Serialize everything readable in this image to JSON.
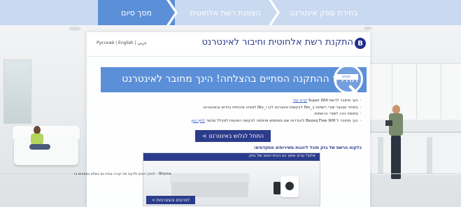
{
  "steps": [
    {
      "label": "מסך סיום",
      "active": true
    },
    {
      "label": "הצפנת רשת אלחוטית",
      "active": false
    },
    {
      "label": "בחירת ספק אינטרנט",
      "active": false
    }
  ],
  "panel": {
    "title": "התקנת רשת אלחוטית וחיבור לאינטרנט",
    "badge": "B",
    "languages": "Русский | English | عربي"
  },
  "banner": {
    "text": "תהליך ההתקנה הסתיים בהצלחה! הינך מחובר לאינטרנט",
    "icon_text": "www"
  },
  "bullets": [
    {
      "text": "הנך מחובר לרשת Super Wifi",
      "link": "קרא עוד"
    },
    {
      "text": "במחיר שבוצר שורי רשתות ב_Niv לבקשות אינטרנט לבו ו_Niv לצפיה איכותית בוידאו ובאינטרנט",
      "link": ""
    },
    {
      "text": "סיסמה זהה לשורי הרשתות.",
      "link": ""
    },
    {
      "text": "הנך מחובר ל Bezeq Free Wifi להגדרות שם משתמש וסיסמה לבקשה הופעות למבלל מכשר",
      "link": "לחץ כאן"
    }
  ],
  "cta": {
    "label": "התחל לגלוש באינטרנט >"
  },
  "promo": {
    "heading": "כלקוח הרשת של בזק תוכל ליהנות משירותים מתקדמים:",
    "bar_text": "אלוף! ערוץ אותך גם הבית הטוב של בזק:",
    "button": "לפרטים והצטרפות >",
    "footnote": "Bhome - לנותן רוצים ולדעת מה קורה בבית גם כשלא נמצאים בו"
  }
}
